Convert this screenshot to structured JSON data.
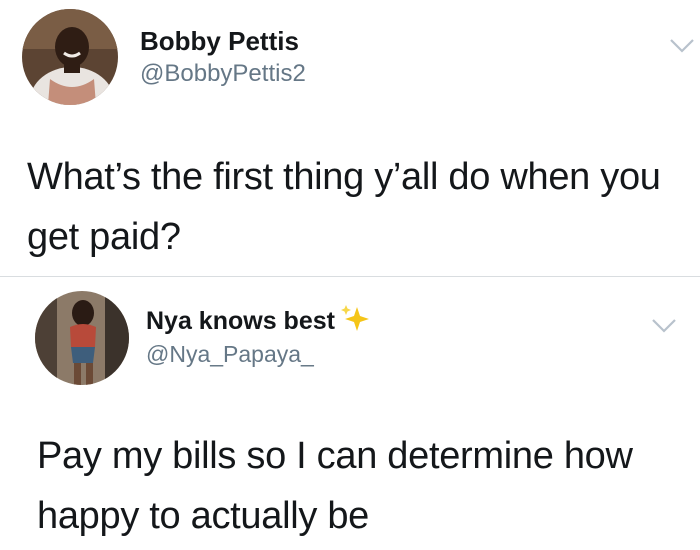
{
  "tweets": [
    {
      "display_name": "Bobby Pettis",
      "handle": "@BobbyPettis2",
      "text": "What’s the first thing y’all do when you get paid?",
      "avatar_icon": "user-avatar",
      "menu_icon": "chevron-down-icon"
    },
    {
      "display_name": "Nya knows best",
      "handle": "@Nya_Papaya_",
      "text": "Pay my bills so I can determine how happy to actually be",
      "avatar_icon": "user-avatar",
      "name_emoji_icon": "sparkles-icon",
      "menu_icon": "chevron-down-icon"
    }
  ],
  "colors": {
    "text": "#14171a",
    "secondary": "#657786",
    "divider": "#d9dde0",
    "chevron": "#b8c2cc",
    "sparkle": "#f5c518"
  }
}
